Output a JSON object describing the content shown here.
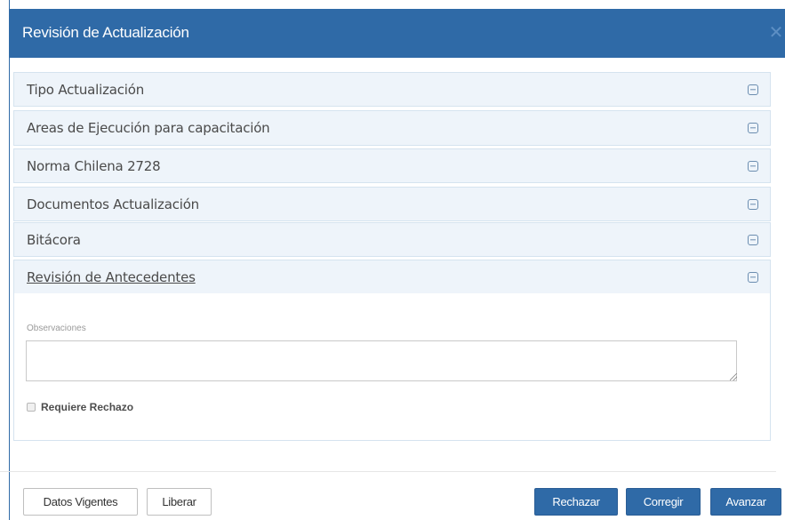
{
  "modal": {
    "title": "Revisión de Actualización",
    "close_icon": "close-icon"
  },
  "panels": [
    {
      "title": "Tipo Actualización",
      "icon": "collapse-icon"
    },
    {
      "title": "Areas de Ejecución para capacitación",
      "icon": "collapse-icon"
    },
    {
      "title": "Norma Chilena 2728",
      "icon": "collapse-icon"
    },
    {
      "title": "Documentos Actualización",
      "icon": "collapse-icon"
    },
    {
      "title": "Bitácora",
      "icon": "collapse-icon"
    },
    {
      "title": "Revisión de Antecedentes",
      "icon": "collapse-icon"
    }
  ],
  "review": {
    "observaciones_label": "Observaciones",
    "observaciones_value": "",
    "requiere_rechazo_label": "Requiere Rechazo",
    "requiere_rechazo_checked": false
  },
  "footer": {
    "datos_vigentes": "Datos Vigentes",
    "liberar": "Liberar",
    "rechazar": "Rechazar",
    "corregir": "Corregir",
    "avanzar": "Avanzar"
  },
  "colors": {
    "primary": "#2f6aa7",
    "panel_header_bg": "#eef4fa",
    "panel_border": "#d5e3ef"
  }
}
